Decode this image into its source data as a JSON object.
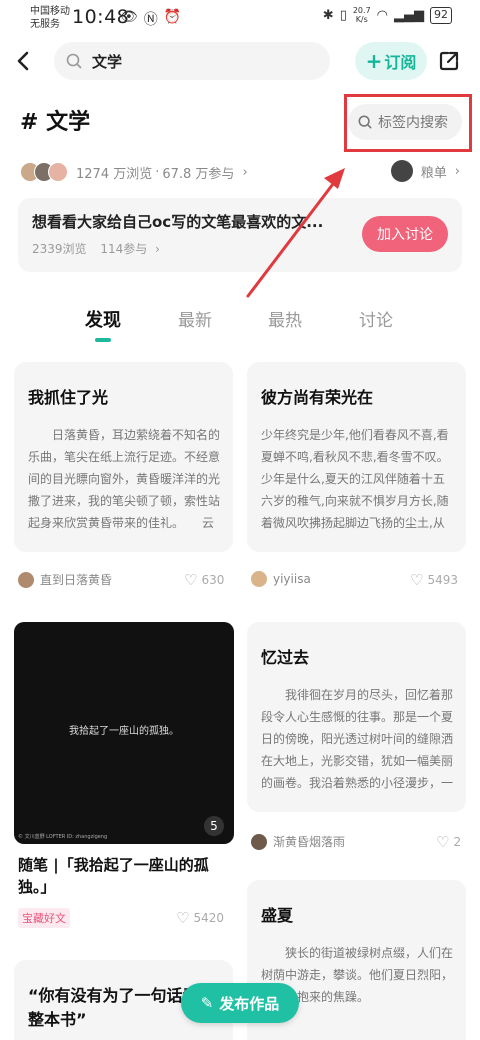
{
  "status_bar": {
    "carrier_line1": "中国移动",
    "carrier_line2": "无服务",
    "time": "10:48",
    "net_speed_value": "20.7",
    "net_speed_unit": "K/s",
    "battery": "92"
  },
  "header": {
    "search_query": "文学",
    "subscribe_label": "订阅"
  },
  "tag": {
    "title": "# 文学",
    "search_placeholder": "标签内搜索",
    "views": "1274 万浏览",
    "participants": "67.8 万参与",
    "ranking_label": "粮单"
  },
  "topic": {
    "title": "想看看大家给自己oc写的文笔最喜欢的文...",
    "views": "2339浏览",
    "participants": "114参与",
    "join_label": "加入讨论"
  },
  "tabs": [
    {
      "label": "发现",
      "active": true
    },
    {
      "label": "最新",
      "active": false
    },
    {
      "label": "最热",
      "active": false
    },
    {
      "label": "讨论",
      "active": false
    }
  ],
  "cards": [
    {
      "title": "我抓住了光",
      "body": "日落黄昏，耳边萦绕着不知名的乐曲，笔尖在纸上流行足迹。不经意间的目光瞟向窗外，黄昏暖洋洋的光撒了进来，我的笔尖顿了顿，索性站起身来欣赏黄昏带来的佳礼。　　云朵好...",
      "author": "直到日落黄昏",
      "likes": "630"
    },
    {
      "title": "彼方尚有荣光在",
      "body": "少年终究是少年,他们看春风不喜,看夏蝉不鸣,看秋风不悲,看冬雪不叹。 少年是什么,夏天的江风伴随着十五六岁的稚气,向来就不惧岁月方长,随着微风吹拂扬起脚边飞扬的尘土,从不回头,猛地向",
      "author": "yiyiisa",
      "likes": "5493"
    },
    {
      "title": "忆过去",
      "body": "我徘徊在岁月的尽头，回忆着那段令人心生感慨的往事。那是一个夏日的傍晚，阳光透过树叶间的缝隙洒在大地上，光影交错，犹如一幅美丽的画卷。我沿着熟悉的小径漫步，一路上，...",
      "author": "渐黄昏烟落雨",
      "likes": "2"
    },
    {
      "title": "盛夏",
      "body": "狭长的街道被绿树点缀，人们在树荫中游走，攀谈。他们夏日烈阳，热浪，抱来的焦躁。",
      "author": "",
      "likes": ""
    }
  ],
  "image_card": {
    "image_text": "我拾起了一座山的孤独。",
    "image_count": "5",
    "watermark": "© 文川蓝野   LOFTER ID: zhangzigeng",
    "title": "随笔 |「我拾起了一座山的孤独。」",
    "badge": "宝藏好文",
    "likes": "5420"
  },
  "partial_card": {
    "title": "“你有没有为了一句话看了整本书”"
  },
  "fab": {
    "label": "发布作品"
  },
  "colors": {
    "accent": "#1fc0a4",
    "join_button": "#f0637a",
    "annotation_red": "#e0393e"
  }
}
